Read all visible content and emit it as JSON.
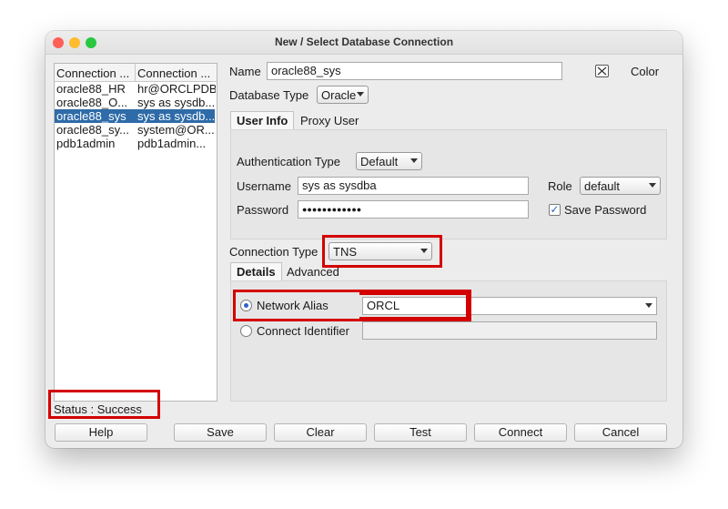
{
  "window": {
    "title": "New / Select Database Connection"
  },
  "connections": {
    "headers": [
      "Connection ...",
      "Connection ..."
    ],
    "rows": [
      {
        "name": "oracle88_HR",
        "details": "hr@ORCLPDB"
      },
      {
        "name": "oracle88_O...",
        "details": "sys as sysdb..."
      },
      {
        "name": "oracle88_sys",
        "details": "sys as sysdb..."
      },
      {
        "name": "oracle88_sy...",
        "details": "system@OR..."
      },
      {
        "name": "pdb1admin",
        "details": "pdb1admin..."
      }
    ],
    "selected_index": 2
  },
  "form": {
    "name_label": "Name",
    "name_value": "oracle88_sys",
    "color_label": "Color",
    "db_type_label": "Database Type",
    "db_type_value": "Oracle",
    "tabs": [
      "User Info",
      "Proxy User"
    ],
    "auth_type_label": "Authentication Type",
    "auth_type_value": "Default",
    "username_label": "Username",
    "username_value": "sys as sysdba",
    "role_label": "Role",
    "role_value": "default",
    "password_label": "Password",
    "password_value": "●●●●●●●●●●●●",
    "save_password_label": "Save Password",
    "save_password_checked": true,
    "conn_type_label": "Connection Type",
    "conn_type_value": "TNS",
    "detail_tabs": [
      "Details",
      "Advanced"
    ],
    "network_alias_label": "Network Alias",
    "network_alias_value": "ORCL",
    "connect_identifier_label": "Connect Identifier",
    "connect_identifier_value": ""
  },
  "status": {
    "text": "Status : Success"
  },
  "buttons": {
    "help": "Help",
    "save": "Save",
    "clear": "Clear",
    "test": "Test",
    "connect": "Connect",
    "cancel": "Cancel"
  },
  "colors": {
    "selection": "#2e6ba8",
    "highlight_box": "#d40000"
  }
}
